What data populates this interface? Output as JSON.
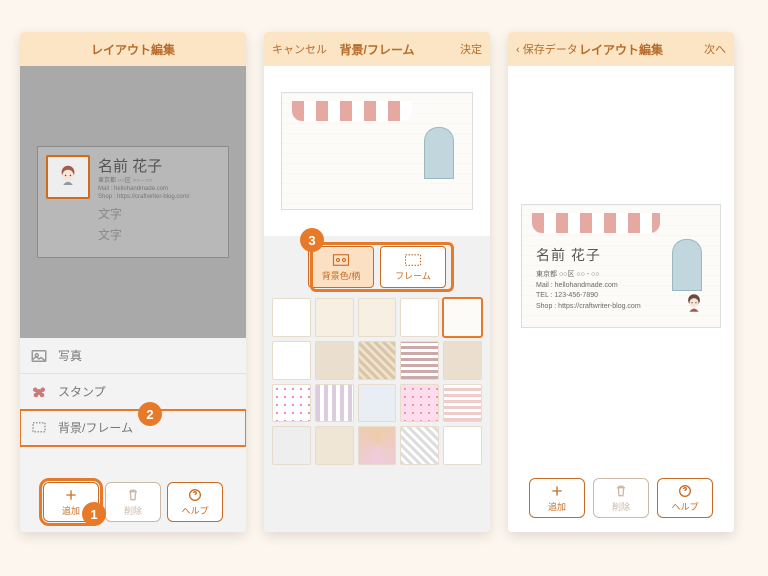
{
  "badges": {
    "b1": "1",
    "b2": "2",
    "b3": "3"
  },
  "phone1": {
    "title": "レイアウト編集",
    "card": {
      "name": "名前 花子",
      "line1": "東京都 ○○区 ○○ - ○○",
      "line2": "Mail : hellohandmade.com",
      "line3": "Shop : https://craftwriter-blog.com/",
      "placeholder": "文字"
    },
    "tools": {
      "photo": "写真",
      "stamp": "スタンプ",
      "bgframe": "背景/フレーム"
    },
    "buttons": {
      "add": "追加",
      "delete": "削除",
      "help": "ヘルプ"
    }
  },
  "phone2": {
    "cancel": "キャンセル",
    "title": "背景/フレーム",
    "done": "決定",
    "tabs": {
      "bg": "背景色/柄",
      "frame": "フレーム"
    }
  },
  "phone3": {
    "back": "保存データ",
    "title": "レイアウト編集",
    "next": "次へ",
    "card": {
      "name": "名前 花子",
      "addr": "東京都 ○○区 ○○ - ○○",
      "mail": "Mail : hellohandmade.com",
      "tel": "TEL : 123-456-7890",
      "shop": "Shop : https://craftwriter-blog.com"
    },
    "buttons": {
      "add": "追加",
      "delete": "削除",
      "help": "ヘルプ"
    }
  }
}
